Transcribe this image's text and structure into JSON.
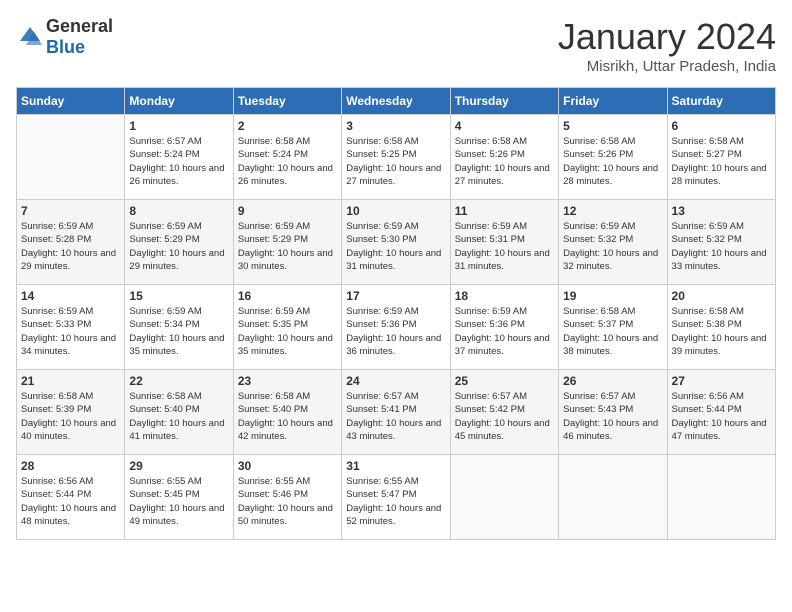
{
  "header": {
    "logo_general": "General",
    "logo_blue": "Blue",
    "month_title": "January 2024",
    "location": "Misrikh, Uttar Pradesh, India"
  },
  "weekdays": [
    "Sunday",
    "Monday",
    "Tuesday",
    "Wednesday",
    "Thursday",
    "Friday",
    "Saturday"
  ],
  "weeks": [
    [
      {
        "day": "",
        "sunrise": "",
        "sunset": "",
        "daylight": ""
      },
      {
        "day": "1",
        "sunrise": "Sunrise: 6:57 AM",
        "sunset": "Sunset: 5:24 PM",
        "daylight": "Daylight: 10 hours and 26 minutes."
      },
      {
        "day": "2",
        "sunrise": "Sunrise: 6:58 AM",
        "sunset": "Sunset: 5:24 PM",
        "daylight": "Daylight: 10 hours and 26 minutes."
      },
      {
        "day": "3",
        "sunrise": "Sunrise: 6:58 AM",
        "sunset": "Sunset: 5:25 PM",
        "daylight": "Daylight: 10 hours and 27 minutes."
      },
      {
        "day": "4",
        "sunrise": "Sunrise: 6:58 AM",
        "sunset": "Sunset: 5:26 PM",
        "daylight": "Daylight: 10 hours and 27 minutes."
      },
      {
        "day": "5",
        "sunrise": "Sunrise: 6:58 AM",
        "sunset": "Sunset: 5:26 PM",
        "daylight": "Daylight: 10 hours and 28 minutes."
      },
      {
        "day": "6",
        "sunrise": "Sunrise: 6:58 AM",
        "sunset": "Sunset: 5:27 PM",
        "daylight": "Daylight: 10 hours and 28 minutes."
      }
    ],
    [
      {
        "day": "7",
        "sunrise": "Sunrise: 6:59 AM",
        "sunset": "Sunset: 5:28 PM",
        "daylight": "Daylight: 10 hours and 29 minutes."
      },
      {
        "day": "8",
        "sunrise": "Sunrise: 6:59 AM",
        "sunset": "Sunset: 5:29 PM",
        "daylight": "Daylight: 10 hours and 29 minutes."
      },
      {
        "day": "9",
        "sunrise": "Sunrise: 6:59 AM",
        "sunset": "Sunset: 5:29 PM",
        "daylight": "Daylight: 10 hours and 30 minutes."
      },
      {
        "day": "10",
        "sunrise": "Sunrise: 6:59 AM",
        "sunset": "Sunset: 5:30 PM",
        "daylight": "Daylight: 10 hours and 31 minutes."
      },
      {
        "day": "11",
        "sunrise": "Sunrise: 6:59 AM",
        "sunset": "Sunset: 5:31 PM",
        "daylight": "Daylight: 10 hours and 31 minutes."
      },
      {
        "day": "12",
        "sunrise": "Sunrise: 6:59 AM",
        "sunset": "Sunset: 5:32 PM",
        "daylight": "Daylight: 10 hours and 32 minutes."
      },
      {
        "day": "13",
        "sunrise": "Sunrise: 6:59 AM",
        "sunset": "Sunset: 5:32 PM",
        "daylight": "Daylight: 10 hours and 33 minutes."
      }
    ],
    [
      {
        "day": "14",
        "sunrise": "Sunrise: 6:59 AM",
        "sunset": "Sunset: 5:33 PM",
        "daylight": "Daylight: 10 hours and 34 minutes."
      },
      {
        "day": "15",
        "sunrise": "Sunrise: 6:59 AM",
        "sunset": "Sunset: 5:34 PM",
        "daylight": "Daylight: 10 hours and 35 minutes."
      },
      {
        "day": "16",
        "sunrise": "Sunrise: 6:59 AM",
        "sunset": "Sunset: 5:35 PM",
        "daylight": "Daylight: 10 hours and 35 minutes."
      },
      {
        "day": "17",
        "sunrise": "Sunrise: 6:59 AM",
        "sunset": "Sunset: 5:36 PM",
        "daylight": "Daylight: 10 hours and 36 minutes."
      },
      {
        "day": "18",
        "sunrise": "Sunrise: 6:59 AM",
        "sunset": "Sunset: 5:36 PM",
        "daylight": "Daylight: 10 hours and 37 minutes."
      },
      {
        "day": "19",
        "sunrise": "Sunrise: 6:58 AM",
        "sunset": "Sunset: 5:37 PM",
        "daylight": "Daylight: 10 hours and 38 minutes."
      },
      {
        "day": "20",
        "sunrise": "Sunrise: 6:58 AM",
        "sunset": "Sunset: 5:38 PM",
        "daylight": "Daylight: 10 hours and 39 minutes."
      }
    ],
    [
      {
        "day": "21",
        "sunrise": "Sunrise: 6:58 AM",
        "sunset": "Sunset: 5:39 PM",
        "daylight": "Daylight: 10 hours and 40 minutes."
      },
      {
        "day": "22",
        "sunrise": "Sunrise: 6:58 AM",
        "sunset": "Sunset: 5:40 PM",
        "daylight": "Daylight: 10 hours and 41 minutes."
      },
      {
        "day": "23",
        "sunrise": "Sunrise: 6:58 AM",
        "sunset": "Sunset: 5:40 PM",
        "daylight": "Daylight: 10 hours and 42 minutes."
      },
      {
        "day": "24",
        "sunrise": "Sunrise: 6:57 AM",
        "sunset": "Sunset: 5:41 PM",
        "daylight": "Daylight: 10 hours and 43 minutes."
      },
      {
        "day": "25",
        "sunrise": "Sunrise: 6:57 AM",
        "sunset": "Sunset: 5:42 PM",
        "daylight": "Daylight: 10 hours and 45 minutes."
      },
      {
        "day": "26",
        "sunrise": "Sunrise: 6:57 AM",
        "sunset": "Sunset: 5:43 PM",
        "daylight": "Daylight: 10 hours and 46 minutes."
      },
      {
        "day": "27",
        "sunrise": "Sunrise: 6:56 AM",
        "sunset": "Sunset: 5:44 PM",
        "daylight": "Daylight: 10 hours and 47 minutes."
      }
    ],
    [
      {
        "day": "28",
        "sunrise": "Sunrise: 6:56 AM",
        "sunset": "Sunset: 5:44 PM",
        "daylight": "Daylight: 10 hours and 48 minutes."
      },
      {
        "day": "29",
        "sunrise": "Sunrise: 6:55 AM",
        "sunset": "Sunset: 5:45 PM",
        "daylight": "Daylight: 10 hours and 49 minutes."
      },
      {
        "day": "30",
        "sunrise": "Sunrise: 6:55 AM",
        "sunset": "Sunset: 5:46 PM",
        "daylight": "Daylight: 10 hours and 50 minutes."
      },
      {
        "day": "31",
        "sunrise": "Sunrise: 6:55 AM",
        "sunset": "Sunset: 5:47 PM",
        "daylight": "Daylight: 10 hours and 52 minutes."
      },
      {
        "day": "",
        "sunrise": "",
        "sunset": "",
        "daylight": ""
      },
      {
        "day": "",
        "sunrise": "",
        "sunset": "",
        "daylight": ""
      },
      {
        "day": "",
        "sunrise": "",
        "sunset": "",
        "daylight": ""
      }
    ]
  ]
}
